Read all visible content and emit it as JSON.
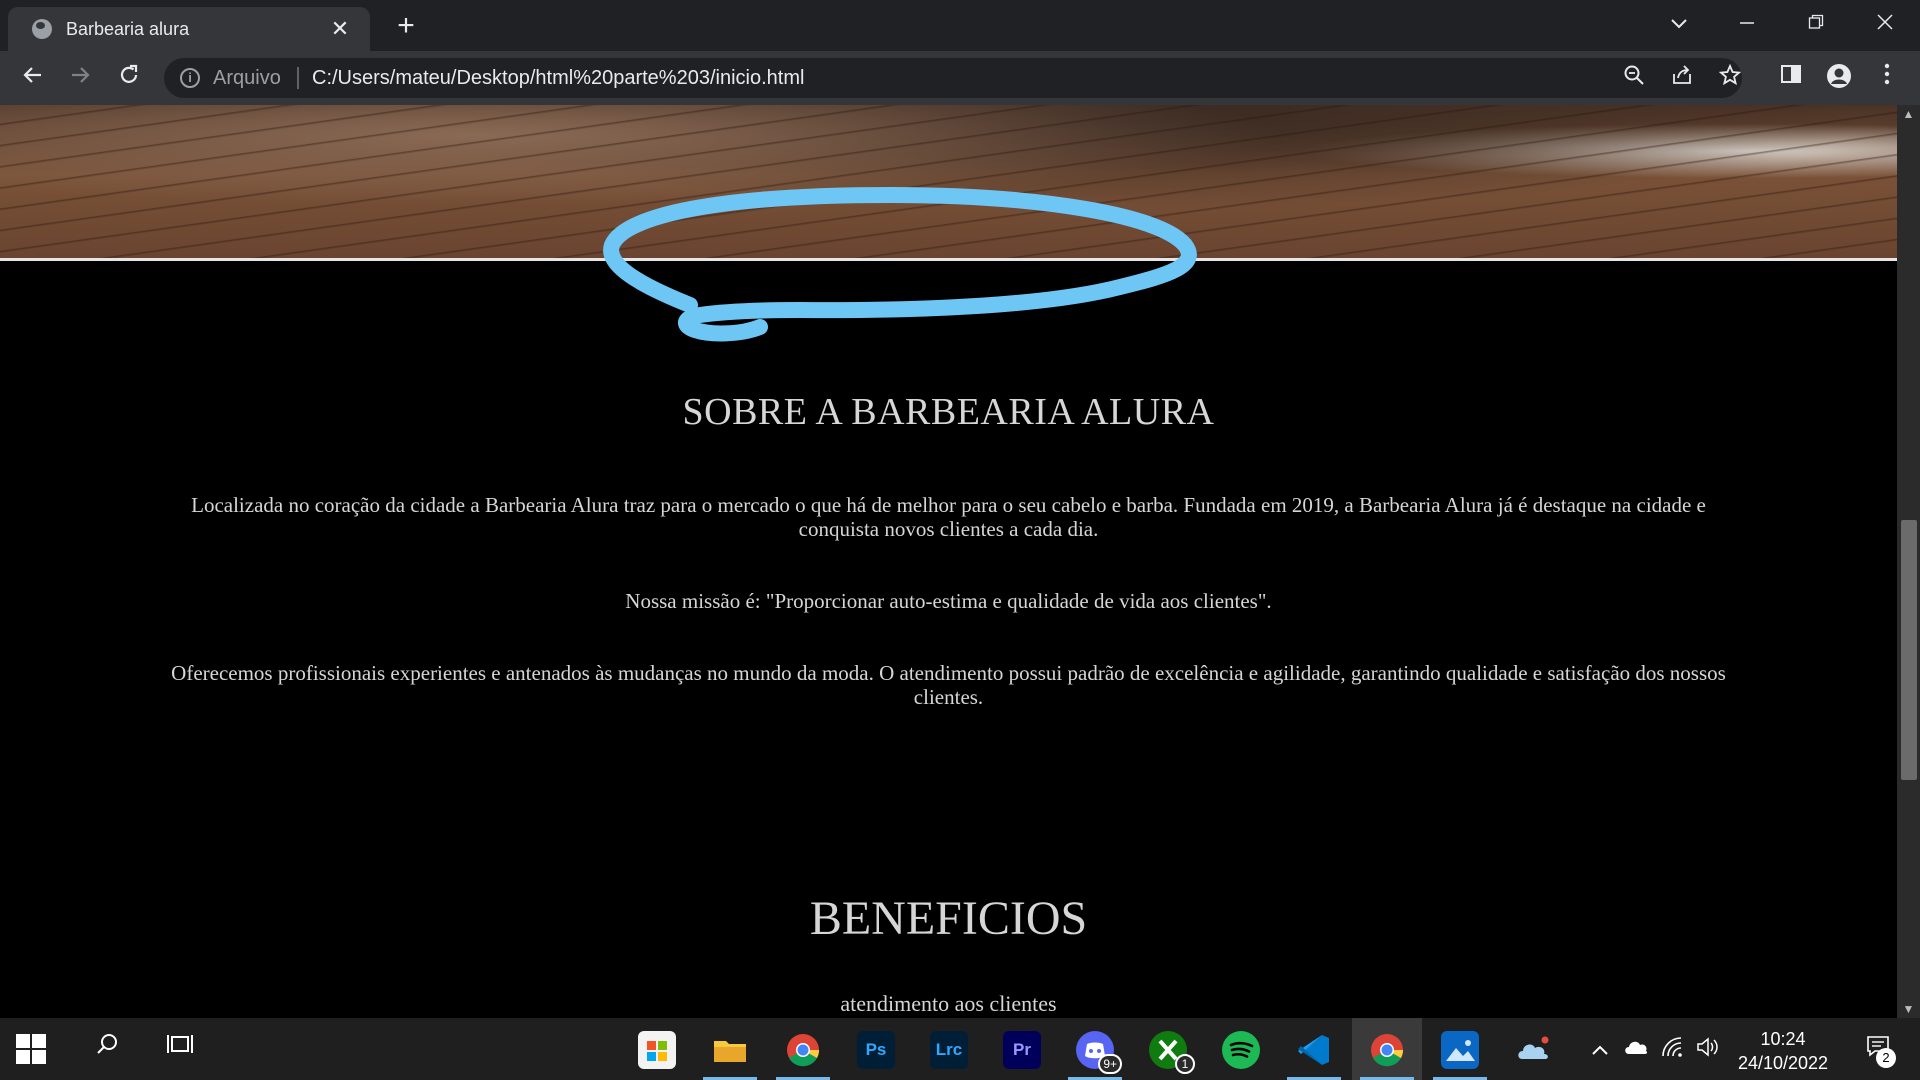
{
  "browser": {
    "tab_title": "Barbearia alura",
    "tab_close": "✕",
    "new_tab": "+",
    "scheme_label": "Arquivo",
    "url": "C:/Users/mateu/Desktop/html%20parte%203/inicio.html",
    "icons": [
      "back-icon",
      "forward-icon",
      "reload-icon",
      "info-icon",
      "zoom-icon",
      "share-icon",
      "star-icon",
      "side-panel-icon",
      "profile-icon",
      "menu-icon"
    ]
  },
  "page": {
    "about_heading": "SOBRE A BARBEARIA ALURA",
    "paragraph_1": "Localizada no coração da cidade a Barbearia Alura traz para o mercado o que há de melhor para o seu cabelo e barba. Fundada em 2019, a Barbearia Alura já é destaque na cidade e conquista novos clientes a cada dia.",
    "paragraph_2": "Nossa missão é: \"Proporcionar auto-estima e qualidade de vida aos clientes\".",
    "paragraph_3": "Oferecemos profissionais experientes e antenados às mudanças no mundo da moda. O atendimento possui padrão de excelência e agilidade, garantindo qualidade e satisfação dos nossos clientes.",
    "benefits_heading": "BENEFICIOS",
    "benefit_item_1": "atendimento aos clientes",
    "annotation_color": "#6ec6f5"
  },
  "taskbar": {
    "apps": [
      {
        "name": "store",
        "label": ""
      },
      {
        "name": "file-explorer",
        "label": ""
      },
      {
        "name": "chrome",
        "label": ""
      },
      {
        "name": "photoshop",
        "label": "Ps"
      },
      {
        "name": "lightroom-classic",
        "label": "Lrc"
      },
      {
        "name": "premiere",
        "label": "Pr"
      },
      {
        "name": "discord",
        "label": "",
        "badge": "9+"
      },
      {
        "name": "xbox",
        "label": "",
        "badge": "1"
      },
      {
        "name": "spotify",
        "label": ""
      },
      {
        "name": "vscode",
        "label": ""
      },
      {
        "name": "chrome-active",
        "label": ""
      },
      {
        "name": "photos",
        "label": ""
      },
      {
        "name": "weather",
        "label": ""
      }
    ],
    "time": "10:24",
    "date": "24/10/2022",
    "notification_count": "2"
  }
}
